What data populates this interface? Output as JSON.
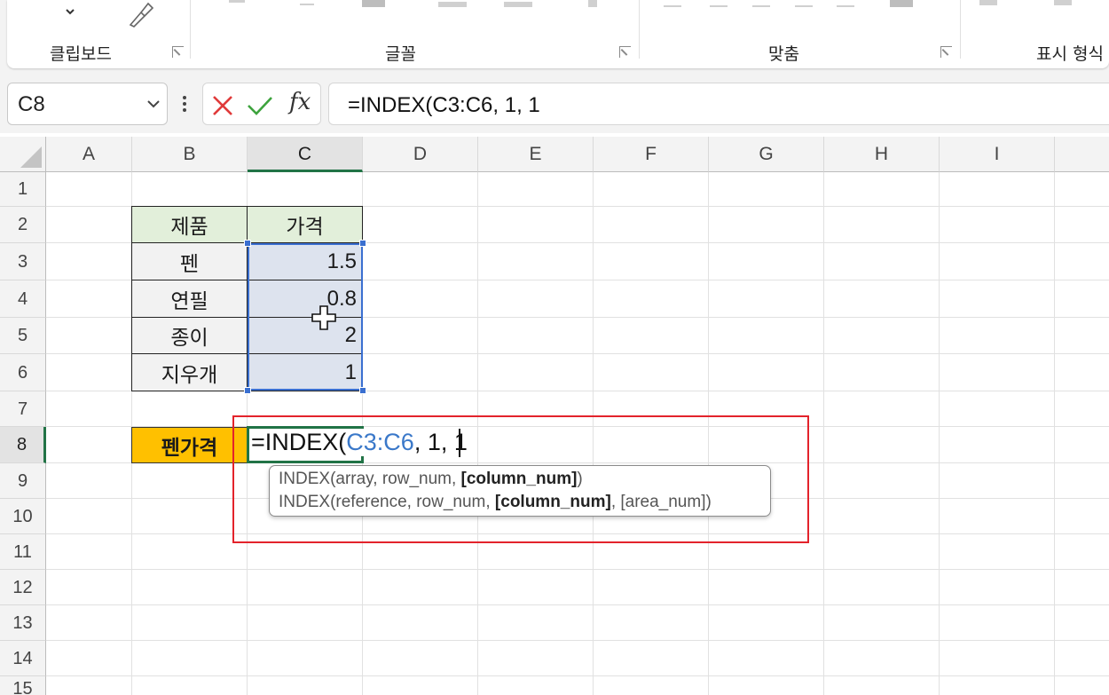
{
  "ribbon": {
    "groups": [
      {
        "label": "클립보드"
      },
      {
        "label": "글꼴"
      },
      {
        "label": "맞춤"
      },
      {
        "label": "표시 형식"
      }
    ],
    "top_icons": [
      "chevron-down-icon",
      "format-painter-icon"
    ]
  },
  "formula_bar": {
    "name_box": "C8",
    "cancel_icon": "x-icon",
    "enter_icon": "check-icon",
    "fx_label": "fx",
    "formula": "=INDEX(C3:C6, 1, 1"
  },
  "grid": {
    "columns": [
      "A",
      "B",
      "C",
      "D",
      "E",
      "F",
      "G",
      "H",
      "I"
    ],
    "rows": [
      "1",
      "2",
      "3",
      "4",
      "5",
      "6",
      "7",
      "8",
      "9",
      "10",
      "11",
      "12",
      "13",
      "14",
      "15"
    ],
    "selected_column": "C",
    "selected_row": "8"
  },
  "table": {
    "header_product": "제품",
    "header_price": "가격",
    "rows": [
      {
        "product": "펜",
        "price": "1.5"
      },
      {
        "product": "연필",
        "price": "0.8"
      },
      {
        "product": "종이",
        "price": "2"
      },
      {
        "product": "지우개",
        "price": "1"
      }
    ]
  },
  "b8_label": "펜가격",
  "edit": {
    "prefix": "=INDEX(",
    "ref": "C3:C6",
    "suffix": ", 1, 1"
  },
  "tooltip": {
    "line1": {
      "pre": "INDEX(array, row_num, ",
      "bold": "[column_num]",
      "post": ")"
    },
    "line2": {
      "pre": "INDEX(reference, row_num, ",
      "bold": "[column_num]",
      "post": ", [area_num])"
    }
  },
  "colors": {
    "header_fill": "#e2efda",
    "product_fill": "#f2f2f2",
    "price_fill": "#dde3ee",
    "b8_fill": "#ffc000",
    "active_cell_border": "#217346",
    "range_ref": "#3a78c9",
    "highlight_box": "#e3232b"
  }
}
